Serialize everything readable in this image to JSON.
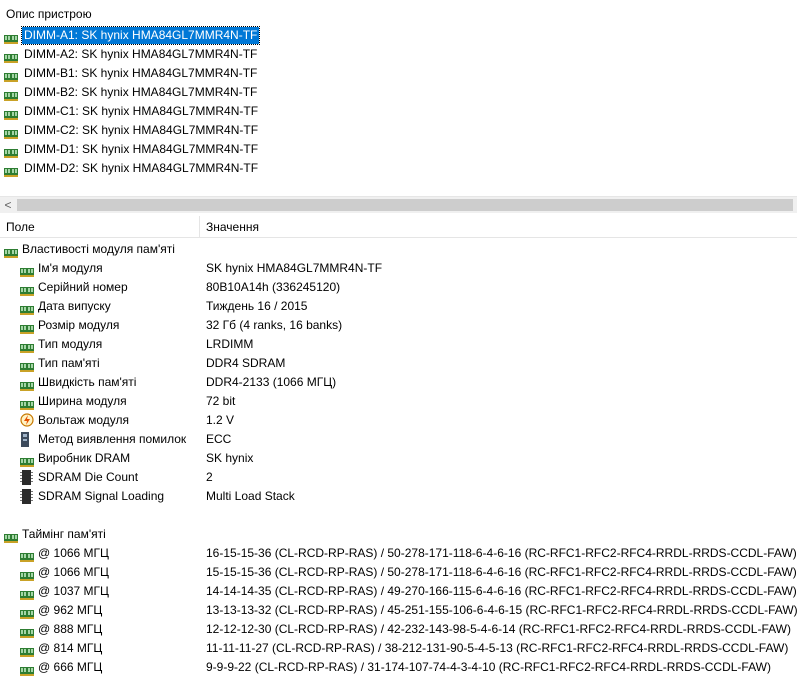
{
  "device_pane": {
    "header": "Опис пристрою",
    "items": [
      {
        "label": "DIMM-A1: SK hynix HMA84GL7MMR4N-TF",
        "selected": true,
        "icon": "ram-module-icon"
      },
      {
        "label": "DIMM-A2: SK hynix HMA84GL7MMR4N-TF",
        "selected": false,
        "icon": "ram-module-icon"
      },
      {
        "label": "DIMM-B1: SK hynix HMA84GL7MMR4N-TF",
        "selected": false,
        "icon": "ram-module-icon"
      },
      {
        "label": "DIMM-B2: SK hynix HMA84GL7MMR4N-TF",
        "selected": false,
        "icon": "ram-module-icon"
      },
      {
        "label": "DIMM-C1: SK hynix HMA84GL7MMR4N-TF",
        "selected": false,
        "icon": "ram-module-icon"
      },
      {
        "label": "DIMM-C2: SK hynix HMA84GL7MMR4N-TF",
        "selected": false,
        "icon": "ram-module-icon"
      },
      {
        "label": "DIMM-D1: SK hynix HMA84GL7MMR4N-TF",
        "selected": false,
        "icon": "ram-module-icon"
      },
      {
        "label": "DIMM-D2: SK hynix HMA84GL7MMR4N-TF",
        "selected": false,
        "icon": "ram-module-icon"
      }
    ]
  },
  "scrollbar": {
    "left_arrow": "<"
  },
  "columns": {
    "field": "Поле",
    "value": "Значення"
  },
  "module_properties": {
    "title": "Властивості модуля пам'яті",
    "rows": [
      {
        "field": "Ім'я модуля",
        "value": "SK hynix HMA84GL7MMR4N-TF",
        "icon": "ram-module-icon"
      },
      {
        "field": "Серійний номер",
        "value": "80B10A14h (336245120)",
        "icon": "ram-module-icon"
      },
      {
        "field": "Дата випуску",
        "value": "Тиждень 16 / 2015",
        "icon": "ram-module-icon"
      },
      {
        "field": "Розмір модуля",
        "value": "32 Гб (4 ranks, 16 banks)",
        "icon": "ram-module-icon"
      },
      {
        "field": "Тип модуля",
        "value": "LRDIMM",
        "icon": "ram-module-icon"
      },
      {
        "field": "Тип пам'яті",
        "value": "DDR4 SDRAM",
        "icon": "ram-module-icon"
      },
      {
        "field": "Швидкість пам'яті",
        "value": "DDR4-2133 (1066 МГЦ)",
        "icon": "ram-module-icon"
      },
      {
        "field": "Ширина модуля",
        "value": "72 bit",
        "icon": "ram-module-icon"
      },
      {
        "field": "Вольтаж модуля",
        "value": "1.2 V",
        "icon": "voltage-icon"
      },
      {
        "field": "Метод виявлення помилок",
        "value": "ECC",
        "icon": "ecc-chip-icon"
      },
      {
        "field": "Виробник DRAM",
        "value": "SK hynix",
        "icon": "ram-module-icon"
      },
      {
        "field": "SDRAM Die Count",
        "value": "2",
        "icon": "die-chip-icon"
      },
      {
        "field": "SDRAM Signal Loading",
        "value": "Multi Load Stack",
        "icon": "die-chip-icon"
      }
    ]
  },
  "timings": {
    "title": "Таймінг пам'яті",
    "rows": [
      {
        "field": "@ 1066 МГЦ",
        "value": "16-15-15-36  (CL-RCD-RP-RAS) / 50-278-171-118-6-4-6-16  (RC-RFC1-RFC2-RFC4-RRDL-RRDS-CCDL-FAW)"
      },
      {
        "field": "@ 1066 МГЦ",
        "value": "15-15-15-36  (CL-RCD-RP-RAS) / 50-278-171-118-6-4-6-16  (RC-RFC1-RFC2-RFC4-RRDL-RRDS-CCDL-FAW)"
      },
      {
        "field": "@ 1037 МГЦ",
        "value": "14-14-14-35  (CL-RCD-RP-RAS) / 49-270-166-115-6-4-6-16  (RC-RFC1-RFC2-RFC4-RRDL-RRDS-CCDL-FAW)"
      },
      {
        "field": "@ 962 МГЦ",
        "value": "13-13-13-32  (CL-RCD-RP-RAS) / 45-251-155-106-6-4-6-15  (RC-RFC1-RFC2-RFC4-RRDL-RRDS-CCDL-FAW)"
      },
      {
        "field": "@ 888 МГЦ",
        "value": "12-12-12-30  (CL-RCD-RP-RAS) / 42-232-143-98-5-4-6-14  (RC-RFC1-RFC2-RFC4-RRDL-RRDS-CCDL-FAW)"
      },
      {
        "field": "@ 814 МГЦ",
        "value": "11-11-11-27  (CL-RCD-RP-RAS) / 38-212-131-90-5-4-5-13  (RC-RFC1-RFC2-RFC4-RRDL-RRDS-CCDL-FAW)"
      },
      {
        "field": "@ 666 МГЦ",
        "value": "9-9-9-22  (CL-RCD-RP-RAS) / 31-174-107-74-4-3-4-10  (RC-RFC1-RFC2-RFC4-RRDL-RRDS-CCDL-FAW)"
      }
    ]
  },
  "colors": {
    "selection": "#0078d7",
    "icon_green": "#2e7d32"
  }
}
